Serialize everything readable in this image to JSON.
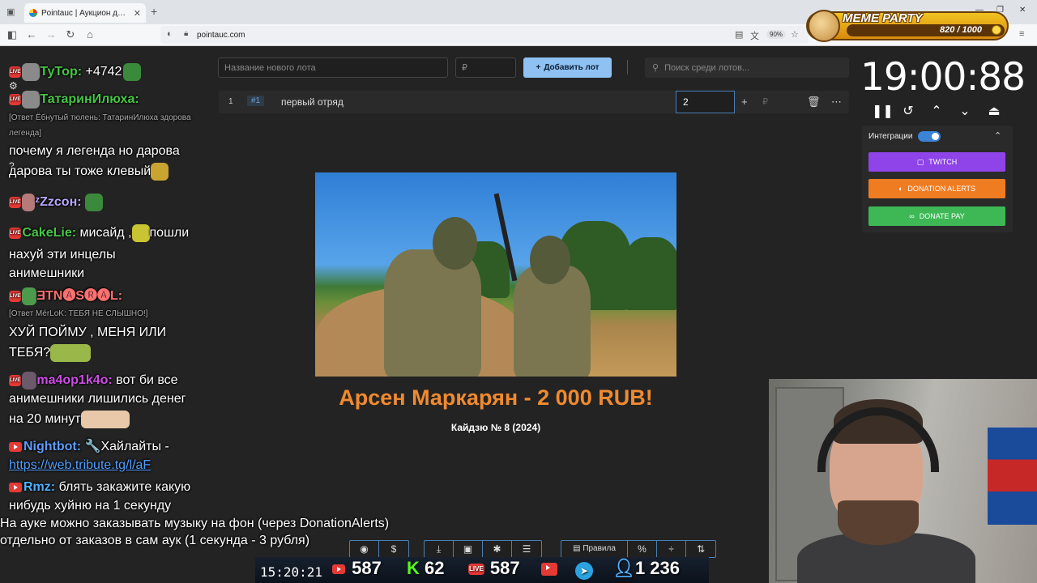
{
  "browser": {
    "tab_title": "Pointauc | Аукцион для стримера",
    "url": "pointauc.com",
    "zoom": "90%"
  },
  "meme_party": {
    "title": "MEME PARTY",
    "score": "820 / 1000"
  },
  "chat": {
    "messages": [
      {
        "user": "ТуТор:",
        "text": "+4742"
      },
      {
        "user": "ТатаринИлюха:",
        "text": ""
      },
      {
        "reply": "[Ответ Ёбнутый тюлень: ТатаринИлюха здорова"
      },
      {
        "reply": "легенда]"
      },
      {
        "text": "почему я легенда но дарова"
      },
      {
        "text": "дарова ты тоже клевый"
      },
      {
        "user": "ᶻZzсон:",
        "text": ""
      },
      {
        "user": "CakeLie:",
        "text": "мисайд ,",
        "text2": "пошли"
      },
      {
        "text": "нахуй эти инцелы"
      },
      {
        "text": "анимешники"
      },
      {
        "user": "ƎTN🅐S🅡🅐L:",
        "text": ""
      },
      {
        "reply": "[Ответ MérLoK: ТЕБЯ НЕ СЛЫШНО!]"
      },
      {
        "text": "ХУЙ ПОЙМУ , МЕНЯ ИЛИ"
      },
      {
        "text": "ТЕБЯ?"
      },
      {
        "user": "ma4op1k4o:",
        "text": "вот би все"
      },
      {
        "text": "анимешники лишились денег"
      },
      {
        "text": "на 20 минут"
      },
      {
        "user": "Nightbot:",
        "text": "🔧Хайлайты -"
      },
      {
        "link": "https://web.tribute.tg/l/aF"
      },
      {
        "user": "Rmz:",
        "text": "блять закажите какую"
      },
      {
        "text": "нибудь хуйню на 1 секунду"
      }
    ]
  },
  "form": {
    "lot_placeholder": "Название нового лота",
    "currency_placeholder": "₽",
    "add_button": "Добавить лот",
    "search_placeholder": "Поиск среди лотов..."
  },
  "lots": [
    {
      "index": "1",
      "id": "#1",
      "name": "первый отряд",
      "amount": "2",
      "currency": "₽"
    }
  ],
  "winner": {
    "title": "Арсен Маркарян - 2 000 RUB!",
    "subtitle": "Кайдзю № 8 (2024)"
  },
  "timer": {
    "value": "19:00:88"
  },
  "integrations": {
    "label": "Интеграции",
    "twitch": "TWITCH",
    "donation_alerts": "DONATION ALERTS",
    "donate_pay": "DONATE PAY",
    "colors": {
      "twitch": "#8e44e8",
      "donation_alerts": "#f07c22",
      "donate_pay": "#3db855"
    }
  },
  "footer": {
    "note_line1": "На ауке можно заказывать музыку на фон (через DonationAlerts)",
    "note_line2": "отдельно от заказов в сам аук (1 секунда - 3 рубля)",
    "rules_label": "Правила",
    "clock": "15:20:21",
    "youtube_viewers": "587",
    "kick_viewers": "62",
    "live_viewers": "587",
    "total_viewers": "1 236"
  }
}
